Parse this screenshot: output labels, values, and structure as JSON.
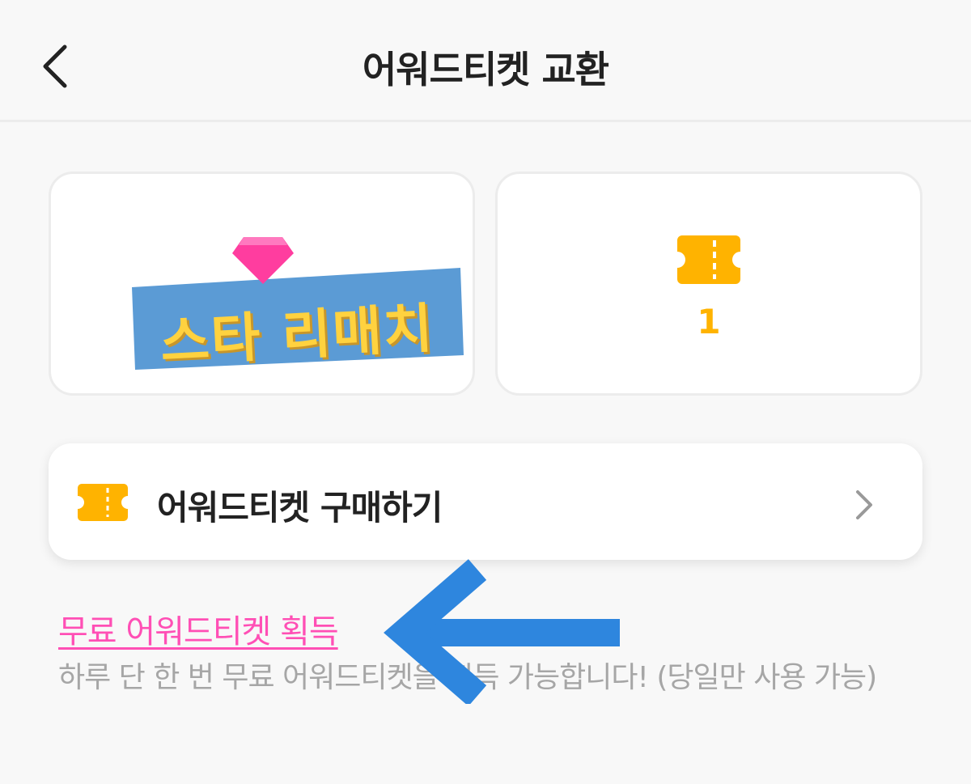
{
  "header": {
    "title": "어워드티켓 교환",
    "back_icon": "chevron-left-icon"
  },
  "cards": {
    "left": {
      "gem_icon": "gem-icon",
      "banner_text": "스타 리매치",
      "colors": {
        "gem": "#ff3d9f",
        "banner": "#5b9bd5",
        "banner_text": "#ffd23f"
      }
    },
    "right": {
      "ticket_icon": "ticket-icon",
      "ticket_count": "1",
      "colors": {
        "ticket": "#ffb300"
      }
    }
  },
  "buy": {
    "label": "어워드티켓 구매하기",
    "icon": "ticket-icon",
    "chevron": "chevron-right-icon"
  },
  "free": {
    "link_text": "무료 어워드티켓 획득",
    "description": "하루 단 한 번 무료 어워드티켓을 획득 가능합니다! (당일만 사용 가능)",
    "link_color": "#ff4fb5",
    "annotation_arrow_color": "#2e86de"
  }
}
